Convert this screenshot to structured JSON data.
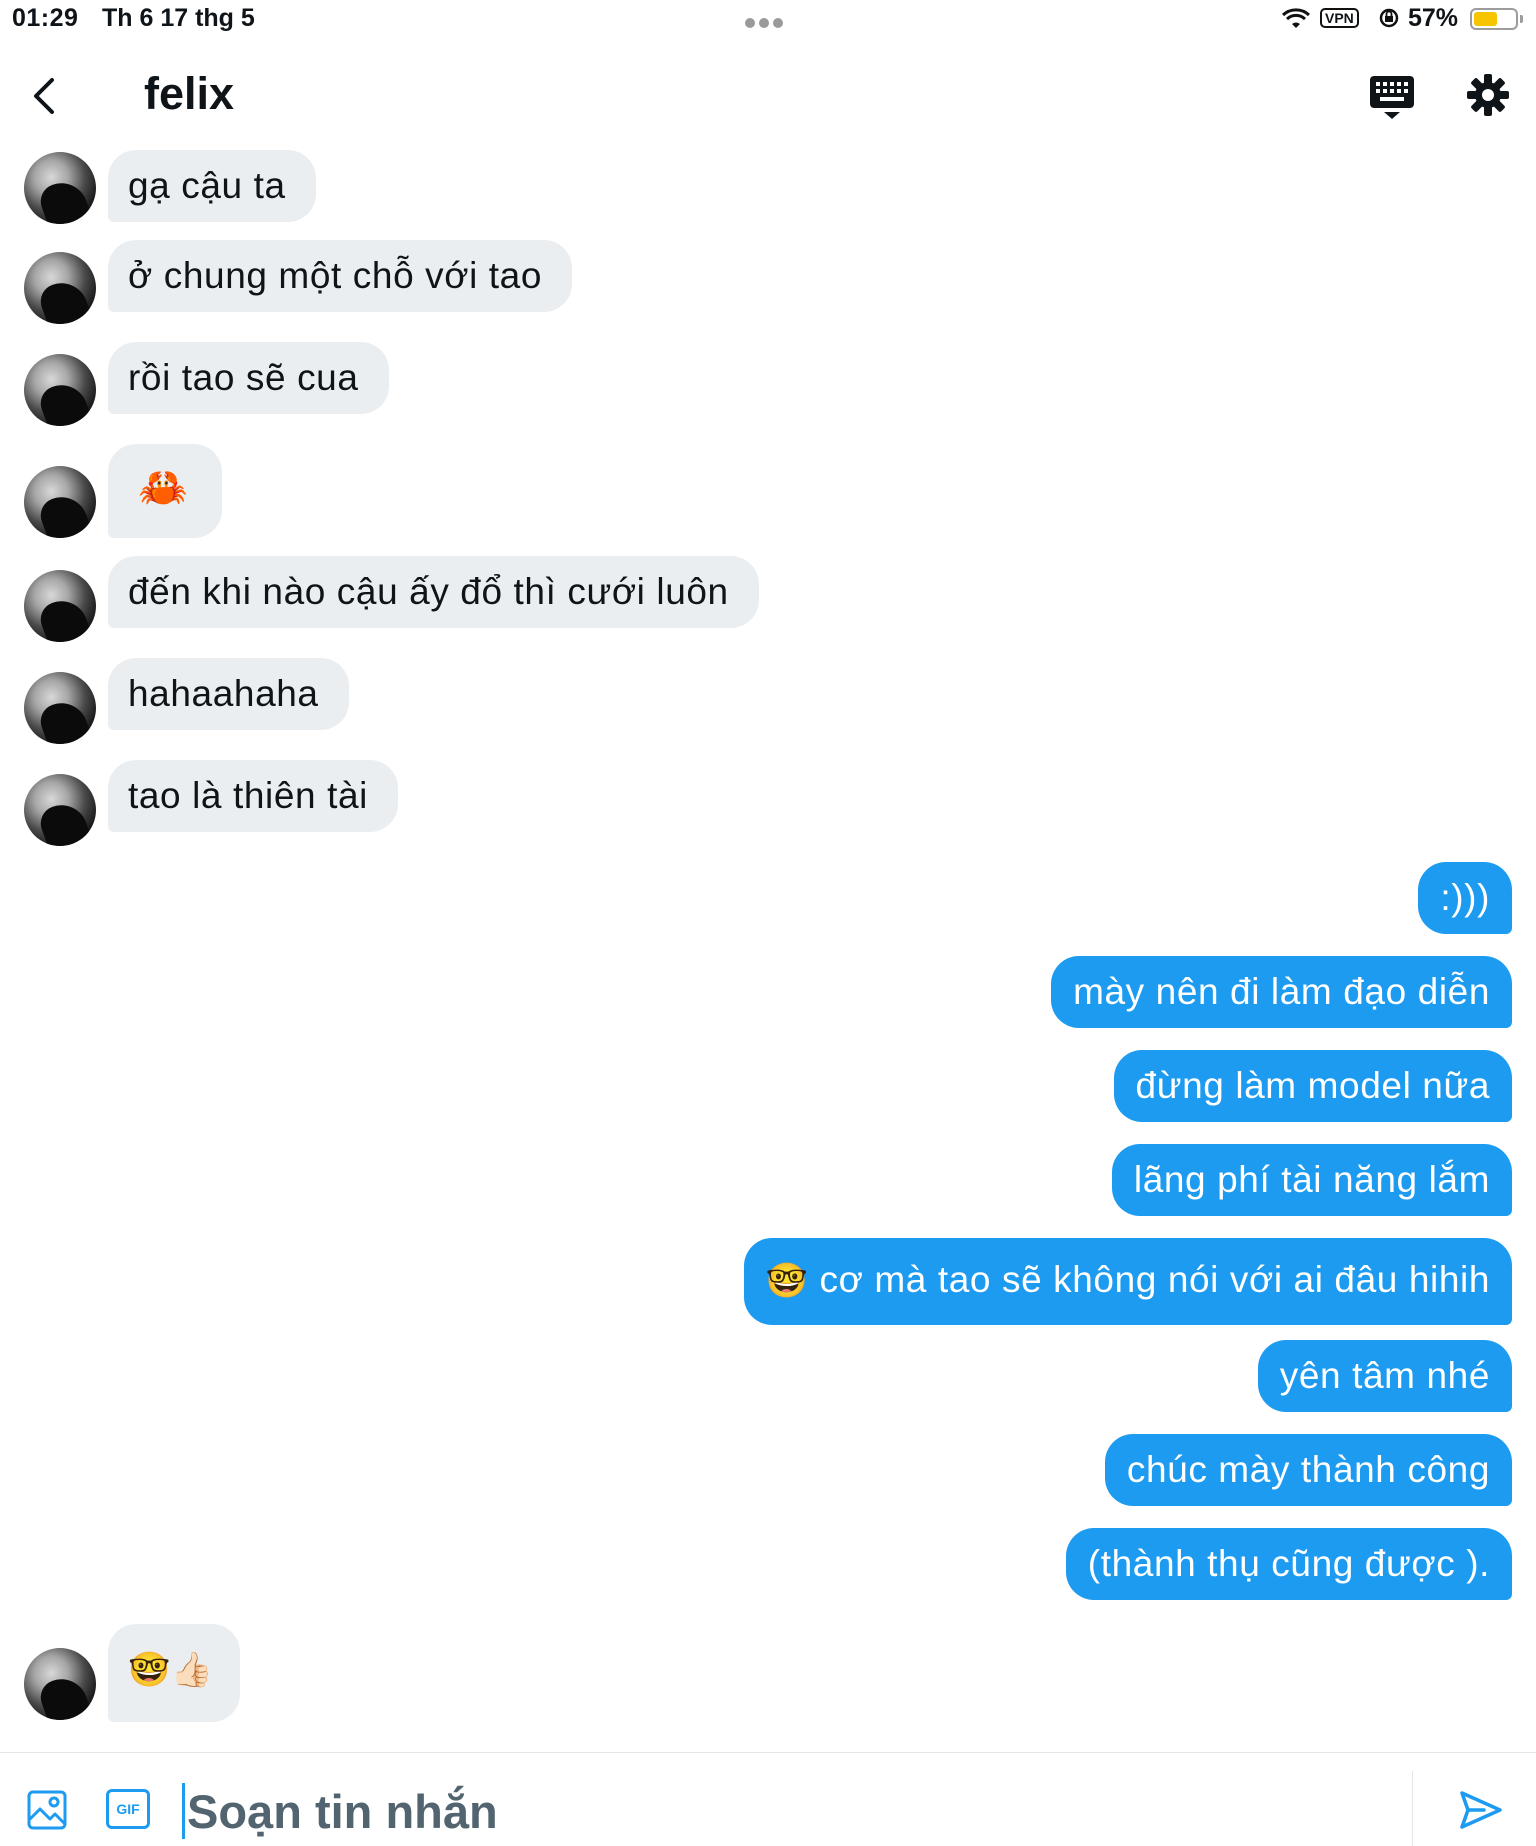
{
  "status_bar": {
    "time": "01:29",
    "date": "Th 6 17 thg 5",
    "vpn_label": "VPN",
    "battery_percent": "57%",
    "battery_level": 0.57
  },
  "header": {
    "title": "felix"
  },
  "incoming_messages": [
    {
      "text": "gạ cậu ta"
    },
    {
      "text": "ở chung một chỗ với tao"
    },
    {
      "text": "rồi tao sẽ cua"
    },
    {
      "text": "🦀"
    },
    {
      "text": "đến khi nào cậu ấy đổ thì cưới luôn"
    },
    {
      "text": "hahaahaha"
    },
    {
      "text": "tao là thiên tài"
    },
    {
      "text": "🤓👍🏻"
    }
  ],
  "outgoing_messages": [
    {
      "text": ":)))"
    },
    {
      "text": "mày nên đi làm đạo diễn"
    },
    {
      "text": "đừng làm model nữa"
    },
    {
      "text": "lãng phí tài năng lắm"
    },
    {
      "emoji": "🤓",
      "text": "cơ mà tao sẽ không nói với ai đâu hihih"
    },
    {
      "text": "yên tâm nhé"
    },
    {
      "text": "chúc mày thành công"
    },
    {
      "text": "(thành thụ cũng được )."
    }
  ],
  "composer": {
    "placeholder": "Soạn tin nhắn",
    "gif_label": "GIF"
  },
  "colors": {
    "accent": "#1d9bf0",
    "incoming_bubble": "#ebeef0",
    "text": "#0f1419"
  },
  "icons": [
    "back-icon",
    "keyboard-icon",
    "gear-icon",
    "image-icon",
    "gif-icon",
    "send-icon",
    "wifi-icon",
    "lock-icon",
    "battery-icon"
  ]
}
